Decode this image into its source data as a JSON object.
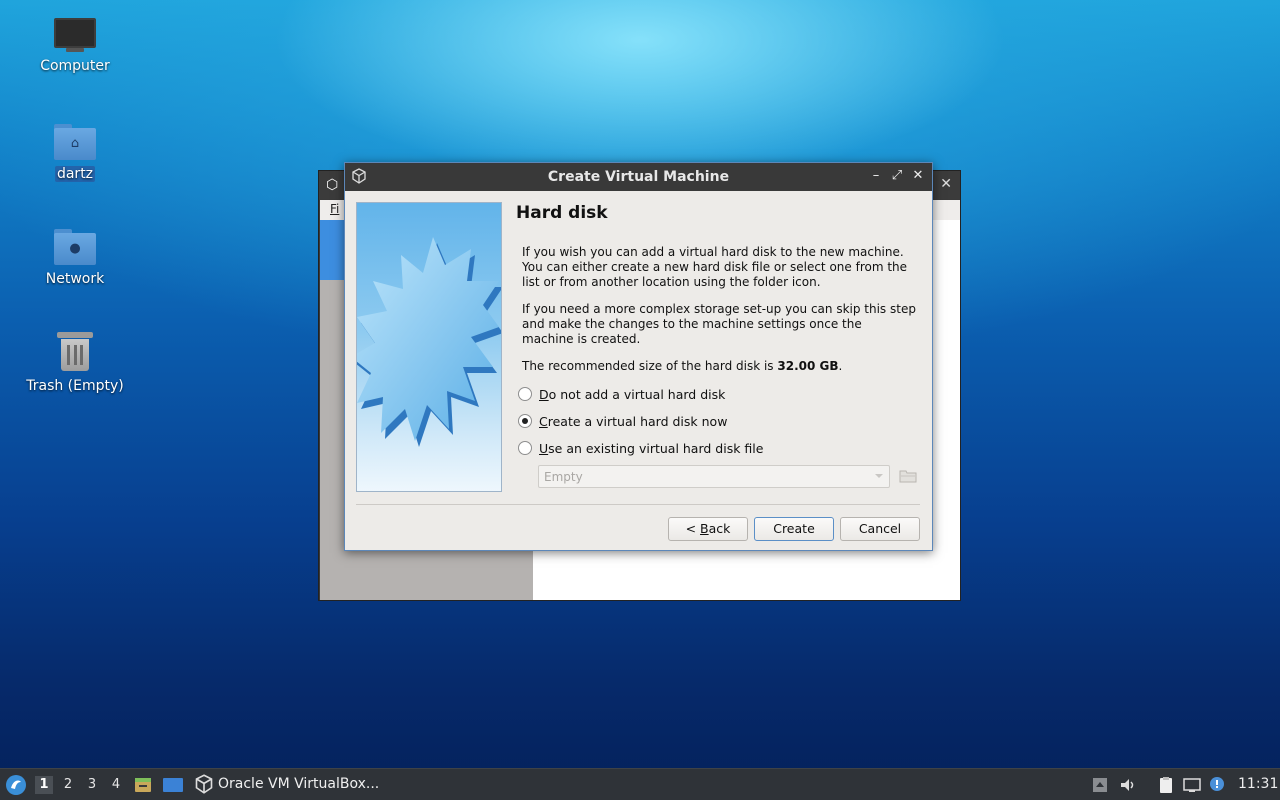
{
  "desktop": {
    "icons": [
      {
        "label": "Computer"
      },
      {
        "label": "dartz"
      },
      {
        "label": "Network"
      },
      {
        "label": "Trash (Empty)"
      }
    ]
  },
  "bg_window": {
    "menu_first": "Fi"
  },
  "dialog": {
    "title": "Create Virtual Machine",
    "page_title": "Hard disk",
    "para1": "If you wish you can add a virtual hard disk to the new machine. You can either create a new hard disk file or select one from the list or from another location using the folder icon.",
    "para2": "If you need a more complex storage set-up you can skip this step and make the changes to the machine settings once the machine is created.",
    "recommended_prefix": "The recommended size of the hard disk is ",
    "recommended_size": "32.00 GB",
    "recommended_suffix": ".",
    "options": [
      {
        "mnemonic": "D",
        "rest": "o not add a virtual hard disk",
        "selected": false
      },
      {
        "mnemonic": "C",
        "rest": "reate a virtual hard disk now",
        "selected": true
      },
      {
        "mnemonic": "U",
        "rest": "se an existing virtual hard disk file",
        "selected": false
      }
    ],
    "combo_value": "Empty",
    "buttons": {
      "back_prefix": "< ",
      "back_mnemonic": "B",
      "back_rest": "ack",
      "create": "Create",
      "cancel": "Cancel"
    }
  },
  "taskbar": {
    "workspaces": [
      "1",
      "2",
      "3",
      "4"
    ],
    "active_workspace": "1",
    "app_title": "Oracle VM VirtualBox...",
    "clock": "11:31"
  },
  "colors": {
    "accent": "#5b8fc7",
    "titlebar": "#393939",
    "taskbar": "#2f3338"
  }
}
